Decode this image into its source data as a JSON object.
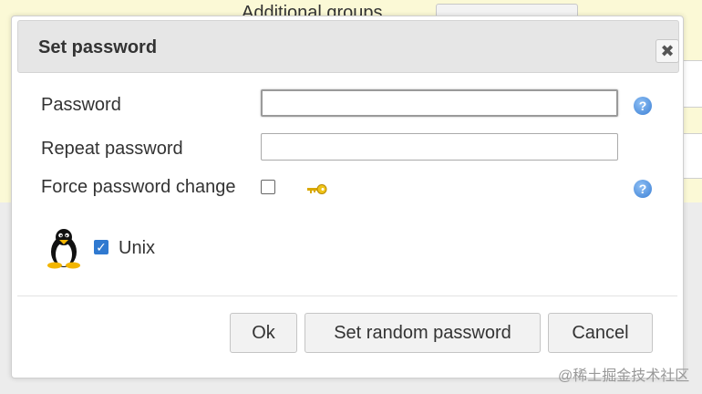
{
  "background": {
    "label": "Additional groups"
  },
  "dialog": {
    "title": "Set password",
    "close_icon": "close-icon",
    "password_label": "Password",
    "repeat_password_label": "Repeat password",
    "force_change_label": "Force password change",
    "force_change_checked": false,
    "unix_label": "Unix",
    "unix_checked": true,
    "help_icon": "?",
    "close_symbol": "✖",
    "buttons": {
      "ok": "Ok",
      "random": "Set random password",
      "cancel": "Cancel"
    }
  },
  "watermark": "@稀土掘金技术社区"
}
